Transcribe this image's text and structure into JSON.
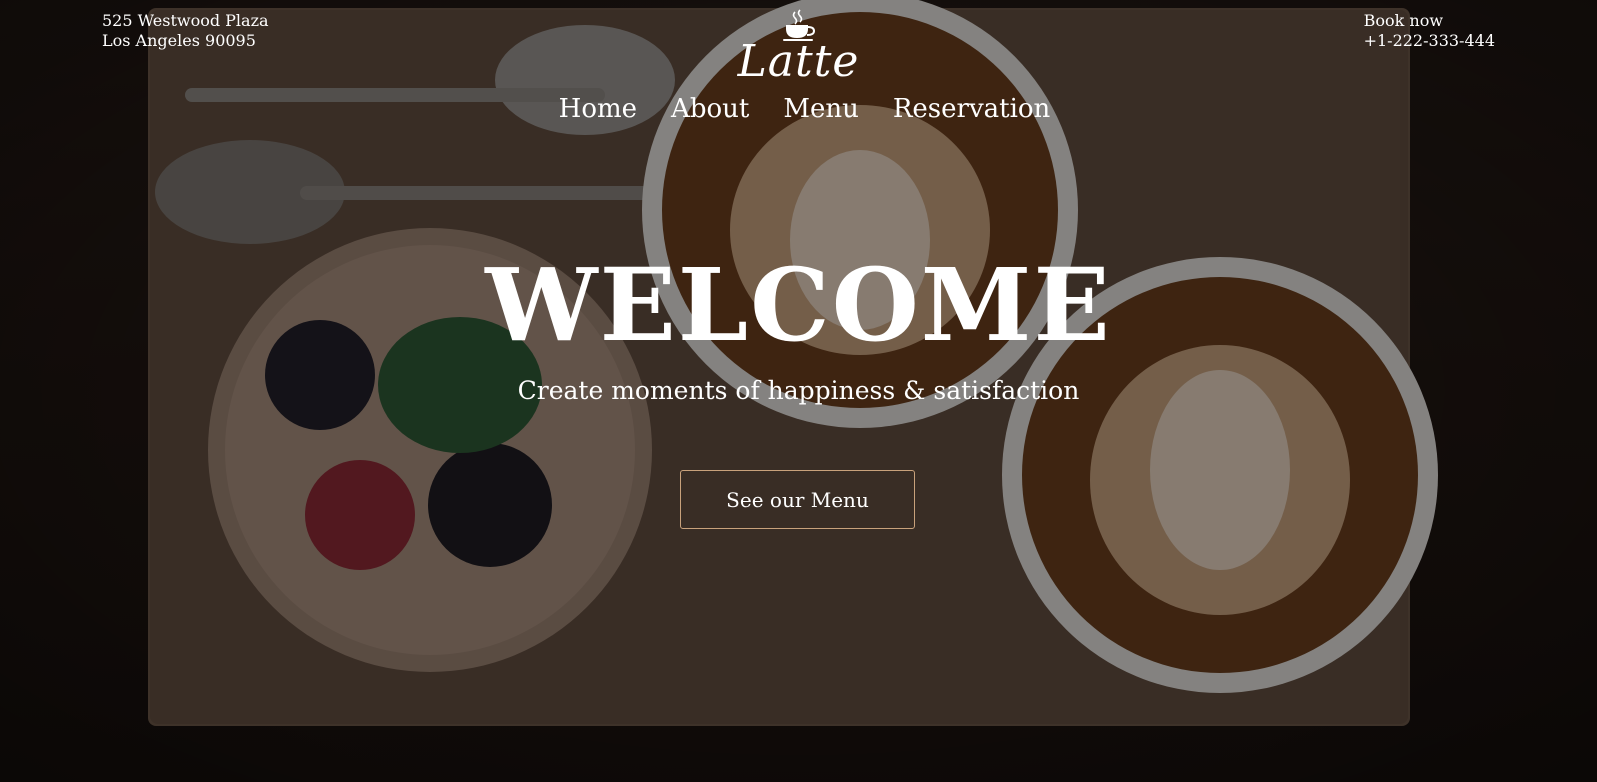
{
  "address": {
    "line1": "525 Westwood Plaza",
    "line2": "Los Angeles 90095"
  },
  "booking": {
    "label": "Book now",
    "phone": "+1-222-333-444"
  },
  "brand": {
    "name": "Latte",
    "icon": "coffee-cup-icon"
  },
  "nav": {
    "items": [
      {
        "label": "Home"
      },
      {
        "label": "About"
      },
      {
        "label": "Menu"
      },
      {
        "label": "Reservation"
      }
    ]
  },
  "hero": {
    "title": "WELCOME",
    "tagline": "Create moments of happiness & satisfaction",
    "cta_label": "See our Menu"
  },
  "colors": {
    "text": "#ffffff",
    "cta_border": "#c9a27c",
    "background": "#1b1310"
  }
}
